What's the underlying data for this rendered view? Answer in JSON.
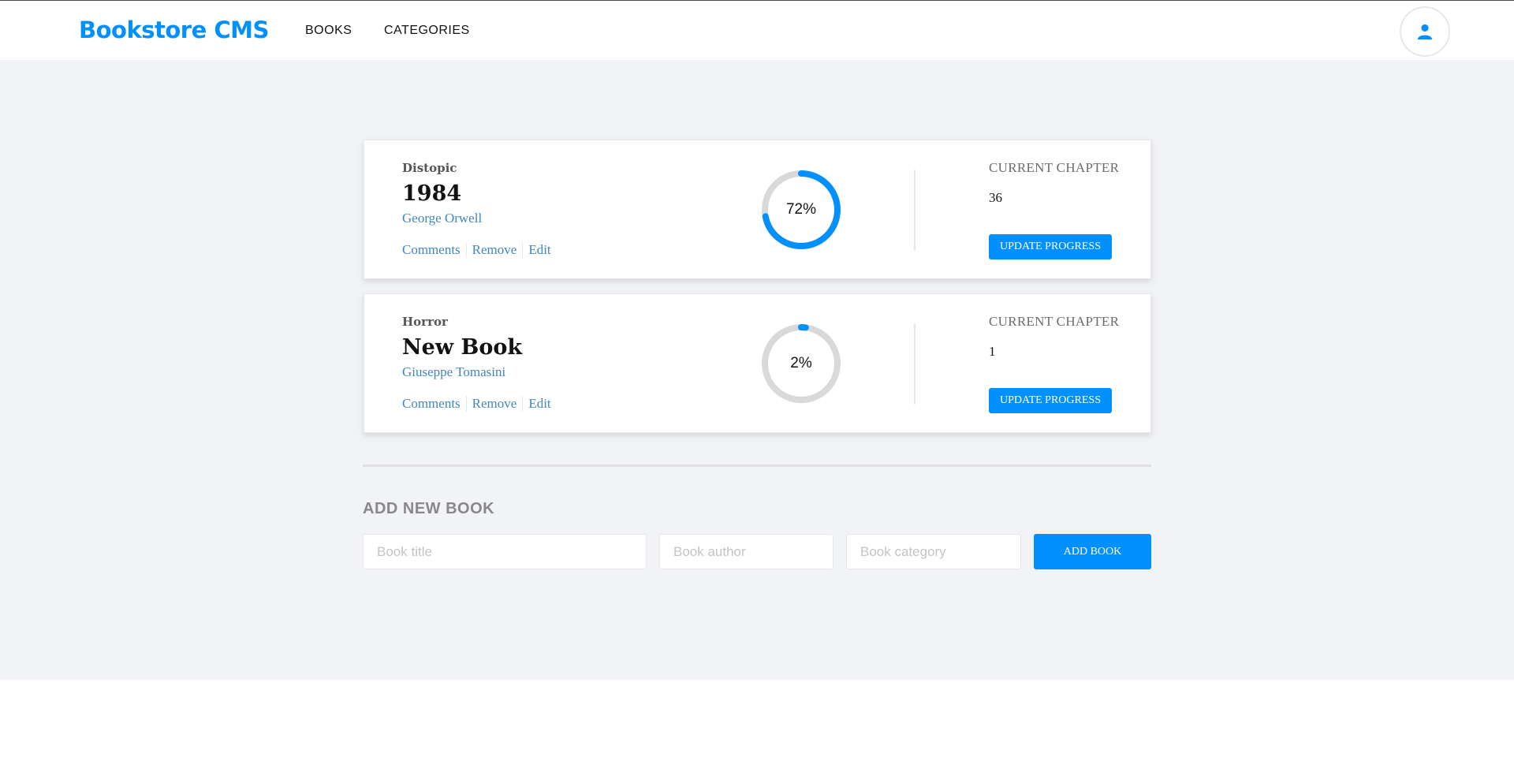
{
  "header": {
    "logo": "Bookstore CMS",
    "nav": [
      "BOOKS",
      "CATEGORIES"
    ],
    "avatar_icon": "user-icon"
  },
  "books": [
    {
      "category": "Distopic",
      "title": "1984",
      "author": "George Orwell",
      "actions": [
        "Comments",
        "Remove",
        "Edit"
      ],
      "progress": 72,
      "progress_label": "72%",
      "chapter_label": "CURRENT CHAPTER",
      "chapter_value": "36",
      "update_button": "UPDATE PROGRESS"
    },
    {
      "category": "Horror",
      "title": "New Book",
      "author": "Giuseppe Tomasini",
      "actions": [
        "Comments",
        "Remove",
        "Edit"
      ],
      "progress": 2,
      "progress_label": "2%",
      "chapter_label": "CURRENT CHAPTER",
      "chapter_value": "1",
      "update_button": "UPDATE PROGRESS"
    }
  ],
  "add_form": {
    "heading": "ADD NEW BOOK",
    "title_placeholder": "Book title",
    "author_placeholder": "Book author",
    "category_placeholder": "Book category",
    "button": "ADD BOOK"
  },
  "colors": {
    "accent": "#0290ff",
    "link": "#4386bf",
    "ring_track": "#d9d9d9",
    "background": "#f1f3f7"
  }
}
